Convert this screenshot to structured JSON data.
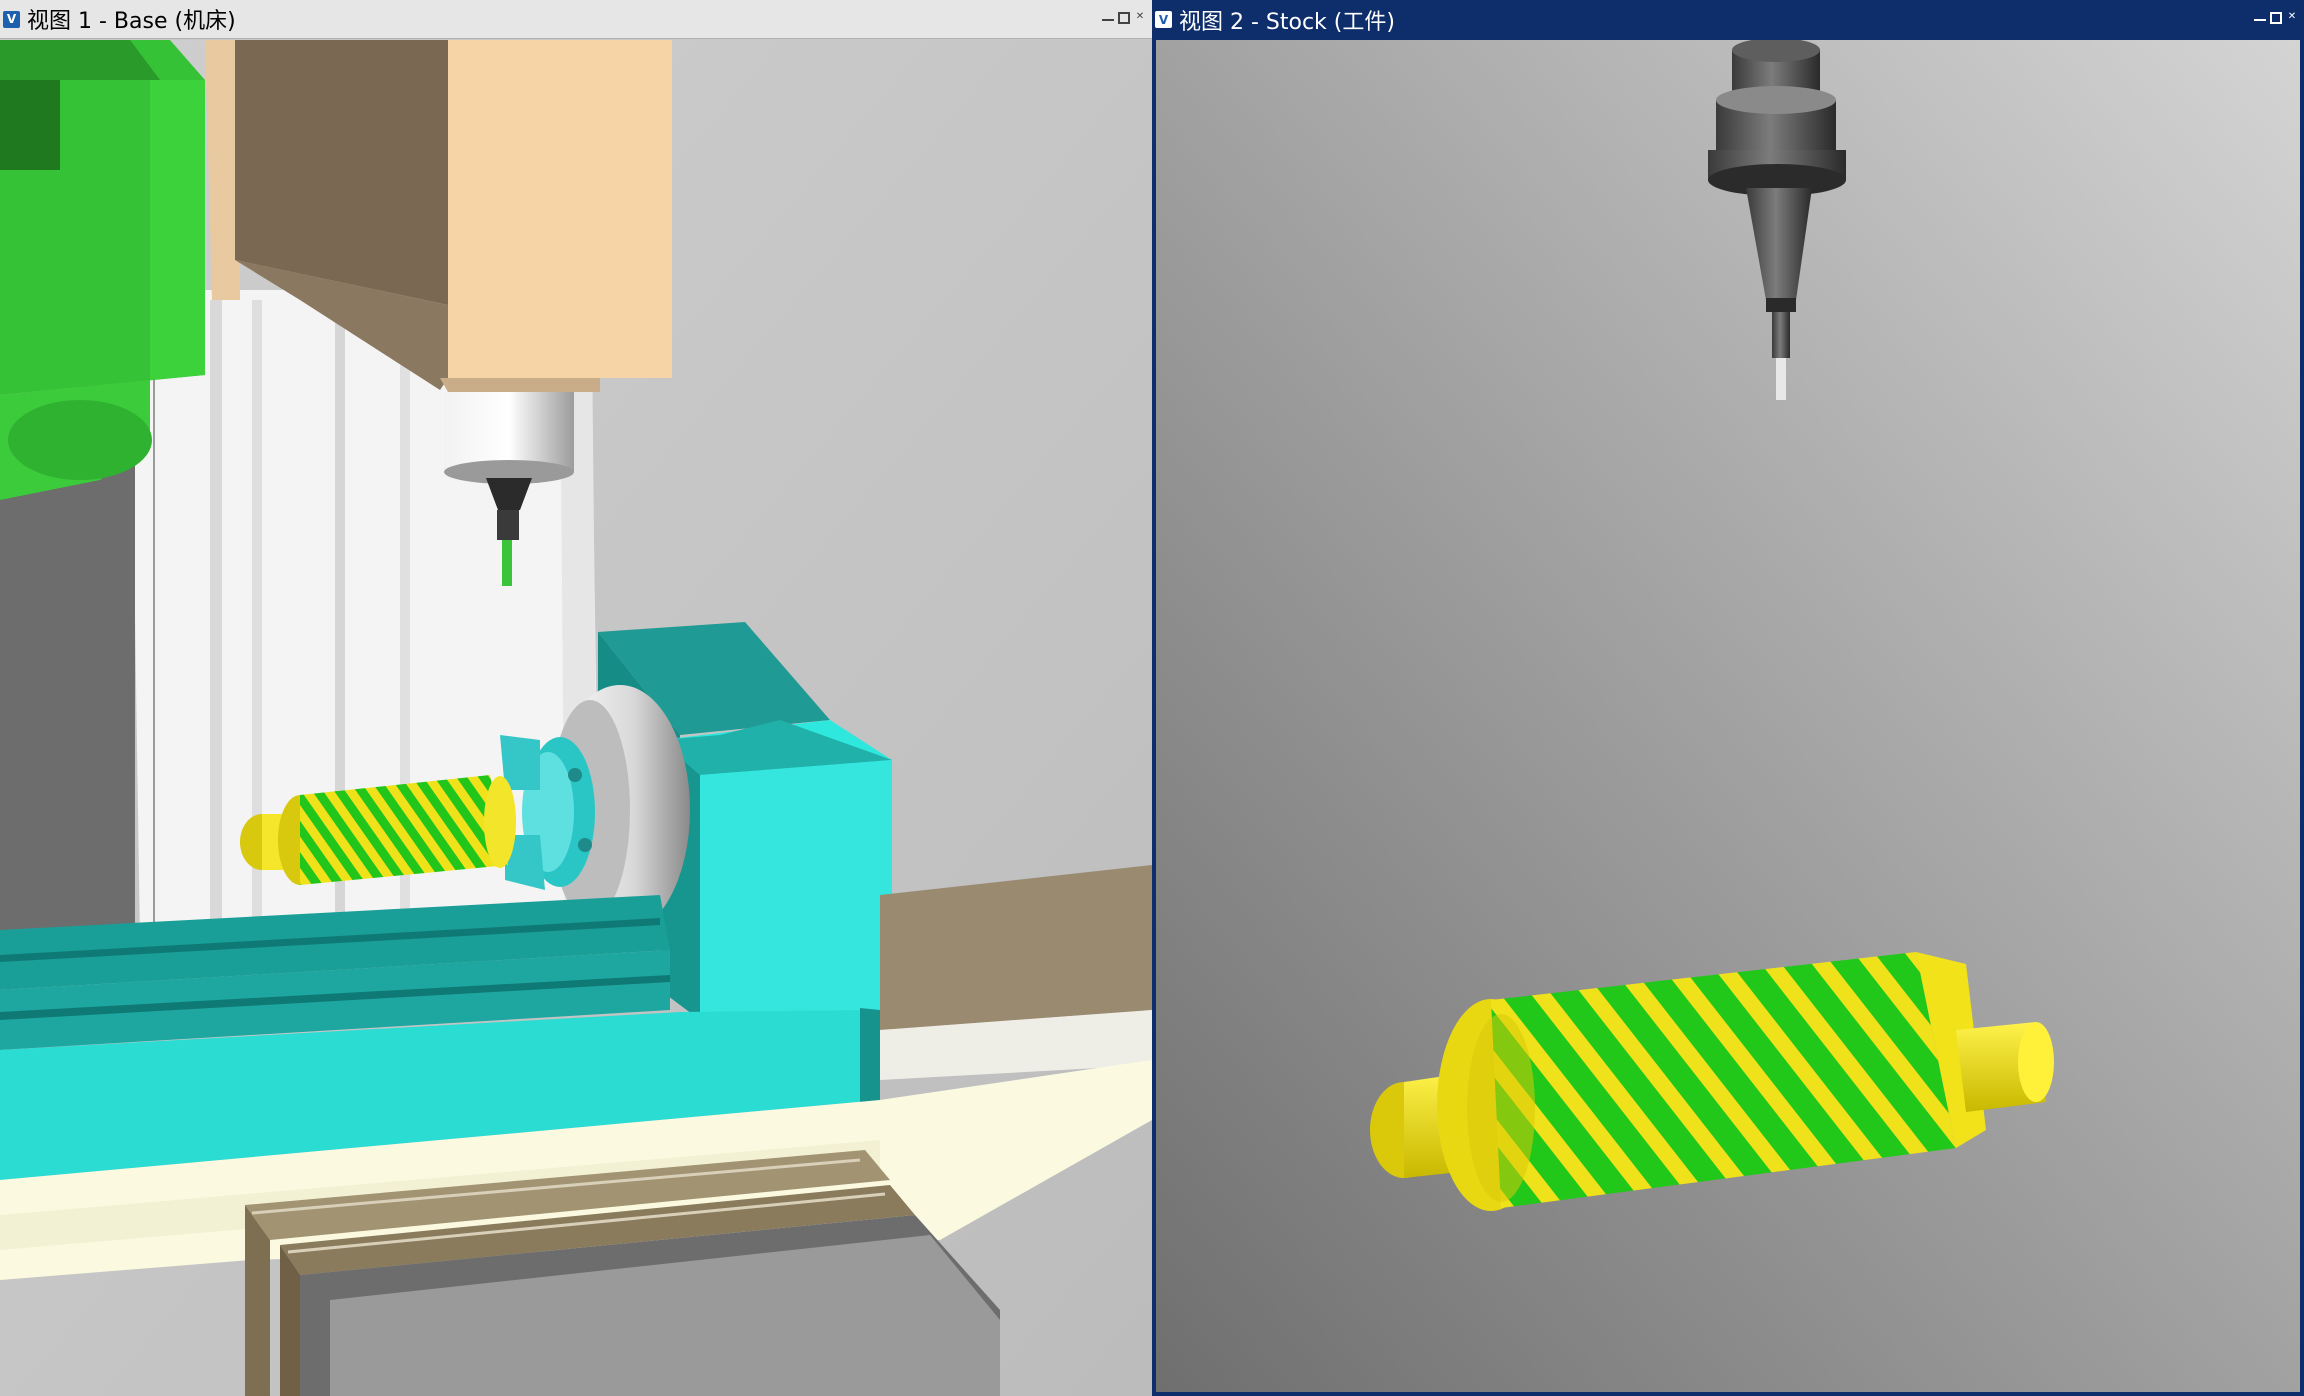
{
  "views": [
    {
      "id": "view1",
      "title": "视图 1 - Base (机床)",
      "icon": "v-icon",
      "controls": [
        "minimize",
        "restore",
        "close"
      ]
    },
    {
      "id": "view2",
      "title": "视图 2 - Stock (工件)",
      "icon": "v-icon",
      "controls": [
        "minimize",
        "restore",
        "close"
      ]
    }
  ],
  "colors": {
    "machine_green": "#3cc83c",
    "table_teal": "#27b4ac",
    "table_cyan": "#2ee8de",
    "head_beige": "#f6d4a6",
    "stock_yellow": "#f0e21a",
    "groove_green": "#22c51a",
    "viewport_bg_light": "#d0d0d0",
    "viewport_bg_dark": "#7a7a7a",
    "active_title_blue": "#0e2e6b"
  }
}
